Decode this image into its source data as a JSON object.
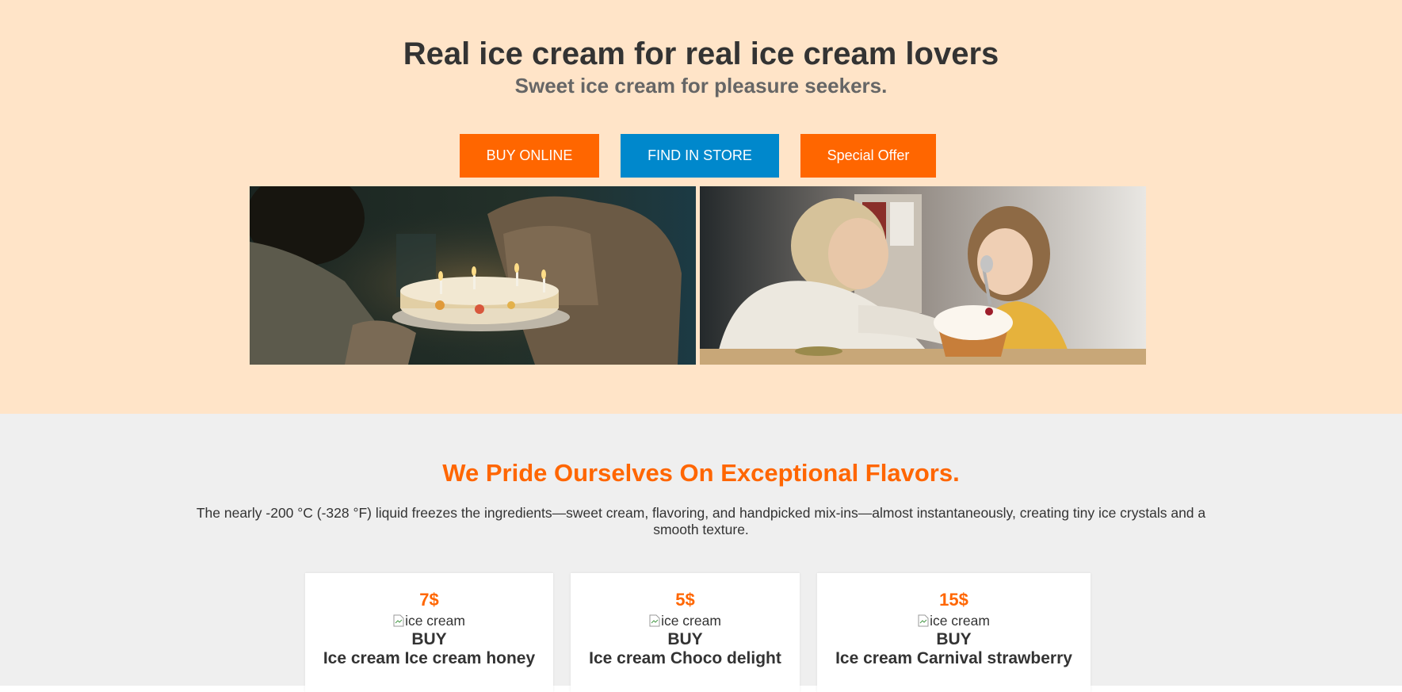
{
  "hero": {
    "title": "Real ice cream for real ice cream lovers",
    "subtitle": "Sweet ice cream for pleasure seekers.",
    "buttons": {
      "buy_online": "BUY ONLINE",
      "find_in_store": "FIND IN STORE",
      "special_offer": "Special Offer"
    },
    "colors": {
      "background": "#ffe4c8",
      "accent": "#ff6600",
      "secondary": "#0088cc"
    }
  },
  "flavors": {
    "title": "We Pride Ourselves On Exceptional Flavors.",
    "description": "The nearly -200 °C (-328 °F) liquid freezes the ingredients—sweet cream, flavoring, and handpicked mix-ins—almost instantaneously, creating tiny ice crystals and a smooth texture.",
    "cards": [
      {
        "price": "7$",
        "image_alt": "ice cream",
        "buy_label": "BUY",
        "name": "Ice cream Ice cream honey"
      },
      {
        "price": "5$",
        "image_alt": "ice cream",
        "buy_label": "BUY",
        "name": "Ice cream Choco delight"
      },
      {
        "price": "15$",
        "image_alt": "ice cream",
        "buy_label": "BUY",
        "name": "Ice cream Carnival strawberry"
      }
    ]
  }
}
